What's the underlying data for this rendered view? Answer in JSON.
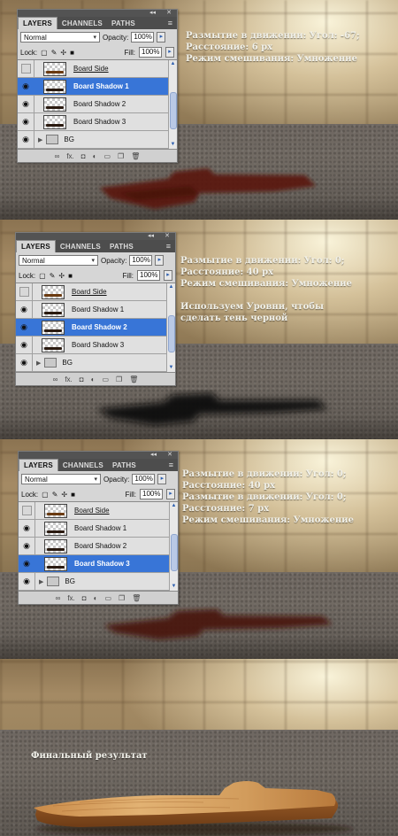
{
  "panel": {
    "tabs": [
      "LAYERS",
      "CHANNELS",
      "PATHS"
    ],
    "blend_mode": "Normal",
    "opacity_label": "Opacity:",
    "opacity_value": "100%",
    "lock_label": "Lock:",
    "fill_label": "Fill:",
    "fill_value": "100%",
    "collapse_glyph": "◂◂",
    "close_glyph": "✕",
    "menu_glyph": "≡",
    "layers": [
      "Board Side",
      "Board Shadow 1",
      "Board Shadow 2",
      "Board Shadow 3",
      "BG"
    ],
    "bottom_icons": [
      "link-icon",
      "fx-icon",
      "mask-icon",
      "adjustment-icon",
      "new-group-icon",
      "new-layer-icon",
      "trash-icon"
    ]
  },
  "steps": [
    {
      "selected_layer": "Board Shadow 1",
      "annotation": [
        "Размытие в движении: Угол: -67;",
        "Расстояние: 6 px",
        "Режим смешивания: Умножение"
      ]
    },
    {
      "selected_layer": "Board Shadow 2",
      "annotation": [
        "Размытие в движении: Угол: 0;",
        "Расстояние: 40 px",
        "Режим смешивания: Умножение",
        "",
        "Используем Уровни, чтобы",
        "сделать тень черной"
      ]
    },
    {
      "selected_layer": "Board Shadow 3",
      "annotation": [
        "Размытие в движении: Угол: 0;",
        "Расстояние: 40 px",
        "Размытие в движении: Угол: 0;",
        "Расстояние: 7 px",
        "Режим смешивания: Умножение"
      ]
    }
  ],
  "final": {
    "caption": "Финальный результат"
  },
  "colors": {
    "selection_blue": "#3875d7",
    "shadow_red": "#5a1508",
    "board_wood": "#d7a062"
  }
}
